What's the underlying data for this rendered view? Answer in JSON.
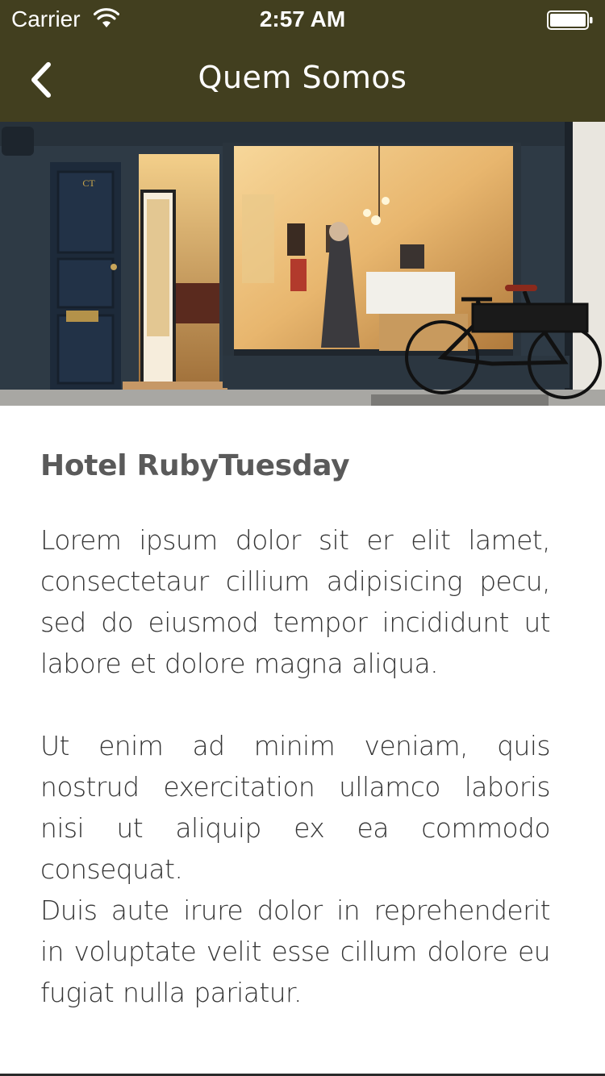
{
  "status_bar": {
    "carrier": "Carrier",
    "time": "2:57 AM",
    "icons": [
      "wifi-icon",
      "battery-icon"
    ]
  },
  "nav": {
    "title": "Quem Somos",
    "back_icon": "chevron-left-icon"
  },
  "hero": {
    "door_sign": "CT"
  },
  "content": {
    "heading": "Hotel RubyTuesday",
    "paragraphs": [
      "Lorem ipsum dolor sit er elit lamet, consectetaur cillium adipisicing pecu, sed do eiusmod tempor incididunt ut labore et dolore magna aliqua.",
      "Ut enim ad minim veniam, quis nostrud exercitation ullamco laboris nisi ut aliquip ex ea commodo consequat.",
      "Duis aute irure dolor in reprehenderit in voluptate velit esse cillum dolore eu fugiat nulla pariatur."
    ]
  },
  "colors": {
    "bar_background": "#423f1f",
    "heading": "#5a5a5a",
    "body_text": "#353535"
  }
}
